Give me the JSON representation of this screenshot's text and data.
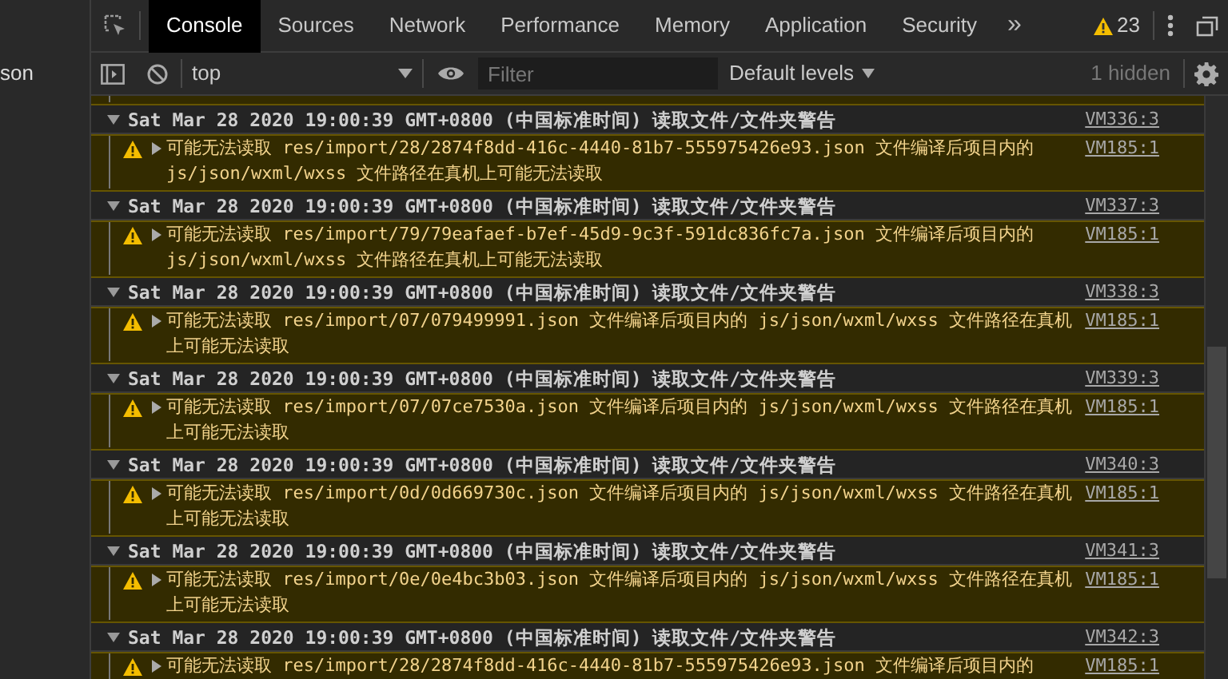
{
  "left_panel": {
    "text": "son"
  },
  "tabs": [
    {
      "label": "Console",
      "selected": true
    },
    {
      "label": "Sources",
      "selected": false
    },
    {
      "label": "Network",
      "selected": false
    },
    {
      "label": "Performance",
      "selected": false
    },
    {
      "label": "Memory",
      "selected": false
    },
    {
      "label": "Application",
      "selected": false
    },
    {
      "label": "Security",
      "selected": false
    }
  ],
  "tabs_overflow": "»",
  "warning_count": "23",
  "toolbar": {
    "context": "top",
    "filter_placeholder": "Filter",
    "levels": "Default levels",
    "hidden": "1 hidden"
  },
  "log": [
    {
      "kind": "warning"
    },
    {
      "kind": "group",
      "message": "Sat Mar 28 2020 19:00:39 GMT+0800 (中国标准时间) 读取文件/文件夹警告",
      "source": "VM336:3"
    },
    {
      "kind": "warning",
      "message": "可能无法读取 res/import/28/2874f8dd-416c-4440-81b7-555975426e93.json 文件编译后项目内的 js/json/wxml/wxss 文件路径在真机上可能无法读取",
      "source": "VM185:1"
    },
    {
      "kind": "group",
      "message": "Sat Mar 28 2020 19:00:39 GMT+0800 (中国标准时间) 读取文件/文件夹警告",
      "source": "VM337:3"
    },
    {
      "kind": "warning",
      "message": "可能无法读取 res/import/79/79eafaef-b7ef-45d9-9c3f-591dc836fc7a.json 文件编译后项目内的 js/json/wxml/wxss 文件路径在真机上可能无法读取",
      "source": "VM185:1"
    },
    {
      "kind": "group",
      "message": "Sat Mar 28 2020 19:00:39 GMT+0800 (中国标准时间) 读取文件/文件夹警告",
      "source": "VM338:3"
    },
    {
      "kind": "warning",
      "message": "可能无法读取 res/import/07/079499991.json 文件编译后项目内的 js/json/wxml/wxss 文件路径在真机上可能无法读取",
      "source": "VM185:1"
    },
    {
      "kind": "group",
      "message": "Sat Mar 28 2020 19:00:39 GMT+0800 (中国标准时间) 读取文件/文件夹警告",
      "source": "VM339:3"
    },
    {
      "kind": "warning",
      "message": "可能无法读取 res/import/07/07ce7530a.json 文件编译后项目内的 js/json/wxml/wxss 文件路径在真机上可能无法读取",
      "source": "VM185:1"
    },
    {
      "kind": "group",
      "message": "Sat Mar 28 2020 19:00:39 GMT+0800 (中国标准时间) 读取文件/文件夹警告",
      "source": "VM340:3"
    },
    {
      "kind": "warning",
      "message": "可能无法读取 res/import/0d/0d669730c.json 文件编译后项目内的 js/json/wxml/wxss 文件路径在真机上可能无法读取",
      "source": "VM185:1"
    },
    {
      "kind": "group",
      "message": "Sat Mar 28 2020 19:00:39 GMT+0800 (中国标准时间) 读取文件/文件夹警告",
      "source": "VM341:3"
    },
    {
      "kind": "warning",
      "message": "可能无法读取 res/import/0e/0e4bc3b03.json 文件编译后项目内的 js/json/wxml/wxss 文件路径在真机上可能无法读取",
      "source": "VM185:1"
    },
    {
      "kind": "group",
      "message": "Sat Mar 28 2020 19:00:39 GMT+0800 (中国标准时间) 读取文件/文件夹警告",
      "source": "VM342:3"
    },
    {
      "kind": "warning",
      "message": "可能无法读取 res/import/28/2874f8dd-416c-4440-81b7-555975426e93.json 文件编译后项目内的",
      "source": "VM185:1"
    }
  ]
}
